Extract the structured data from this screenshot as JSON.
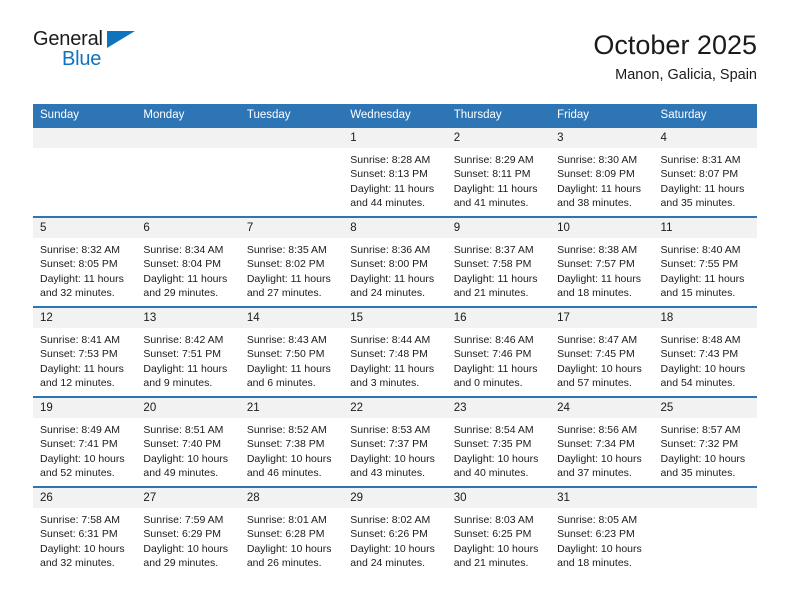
{
  "brand": {
    "line1": "General",
    "line2": "Blue",
    "flag_icon": "triangle-flag-icon",
    "accent_color": "#1073bd"
  },
  "header": {
    "title": "October 2025",
    "subtitle": "Manon, Galicia, Spain"
  },
  "calendar": {
    "header_color": "#2e75b6",
    "daynum_bg": "#f2f2f2",
    "weekdays": [
      "Sunday",
      "Monday",
      "Tuesday",
      "Wednesday",
      "Thursday",
      "Friday",
      "Saturday"
    ],
    "weeks": [
      [
        {
          "day": "",
          "sunrise": "",
          "sunset": "",
          "daylight1": "",
          "daylight2": ""
        },
        {
          "day": "",
          "sunrise": "",
          "sunset": "",
          "daylight1": "",
          "daylight2": ""
        },
        {
          "day": "",
          "sunrise": "",
          "sunset": "",
          "daylight1": "",
          "daylight2": ""
        },
        {
          "day": "1",
          "sunrise": "Sunrise: 8:28 AM",
          "sunset": "Sunset: 8:13 PM",
          "daylight1": "Daylight: 11 hours",
          "daylight2": "and 44 minutes."
        },
        {
          "day": "2",
          "sunrise": "Sunrise: 8:29 AM",
          "sunset": "Sunset: 8:11 PM",
          "daylight1": "Daylight: 11 hours",
          "daylight2": "and 41 minutes."
        },
        {
          "day": "3",
          "sunrise": "Sunrise: 8:30 AM",
          "sunset": "Sunset: 8:09 PM",
          "daylight1": "Daylight: 11 hours",
          "daylight2": "and 38 minutes."
        },
        {
          "day": "4",
          "sunrise": "Sunrise: 8:31 AM",
          "sunset": "Sunset: 8:07 PM",
          "daylight1": "Daylight: 11 hours",
          "daylight2": "and 35 minutes."
        }
      ],
      [
        {
          "day": "5",
          "sunrise": "Sunrise: 8:32 AM",
          "sunset": "Sunset: 8:05 PM",
          "daylight1": "Daylight: 11 hours",
          "daylight2": "and 32 minutes."
        },
        {
          "day": "6",
          "sunrise": "Sunrise: 8:34 AM",
          "sunset": "Sunset: 8:04 PM",
          "daylight1": "Daylight: 11 hours",
          "daylight2": "and 29 minutes."
        },
        {
          "day": "7",
          "sunrise": "Sunrise: 8:35 AM",
          "sunset": "Sunset: 8:02 PM",
          "daylight1": "Daylight: 11 hours",
          "daylight2": "and 27 minutes."
        },
        {
          "day": "8",
          "sunrise": "Sunrise: 8:36 AM",
          "sunset": "Sunset: 8:00 PM",
          "daylight1": "Daylight: 11 hours",
          "daylight2": "and 24 minutes."
        },
        {
          "day": "9",
          "sunrise": "Sunrise: 8:37 AM",
          "sunset": "Sunset: 7:58 PM",
          "daylight1": "Daylight: 11 hours",
          "daylight2": "and 21 minutes."
        },
        {
          "day": "10",
          "sunrise": "Sunrise: 8:38 AM",
          "sunset": "Sunset: 7:57 PM",
          "daylight1": "Daylight: 11 hours",
          "daylight2": "and 18 minutes."
        },
        {
          "day": "11",
          "sunrise": "Sunrise: 8:40 AM",
          "sunset": "Sunset: 7:55 PM",
          "daylight1": "Daylight: 11 hours",
          "daylight2": "and 15 minutes."
        }
      ],
      [
        {
          "day": "12",
          "sunrise": "Sunrise: 8:41 AM",
          "sunset": "Sunset: 7:53 PM",
          "daylight1": "Daylight: 11 hours",
          "daylight2": "and 12 minutes."
        },
        {
          "day": "13",
          "sunrise": "Sunrise: 8:42 AM",
          "sunset": "Sunset: 7:51 PM",
          "daylight1": "Daylight: 11 hours",
          "daylight2": "and 9 minutes."
        },
        {
          "day": "14",
          "sunrise": "Sunrise: 8:43 AM",
          "sunset": "Sunset: 7:50 PM",
          "daylight1": "Daylight: 11 hours",
          "daylight2": "and 6 minutes."
        },
        {
          "day": "15",
          "sunrise": "Sunrise: 8:44 AM",
          "sunset": "Sunset: 7:48 PM",
          "daylight1": "Daylight: 11 hours",
          "daylight2": "and 3 minutes."
        },
        {
          "day": "16",
          "sunrise": "Sunrise: 8:46 AM",
          "sunset": "Sunset: 7:46 PM",
          "daylight1": "Daylight: 11 hours",
          "daylight2": "and 0 minutes."
        },
        {
          "day": "17",
          "sunrise": "Sunrise: 8:47 AM",
          "sunset": "Sunset: 7:45 PM",
          "daylight1": "Daylight: 10 hours",
          "daylight2": "and 57 minutes."
        },
        {
          "day": "18",
          "sunrise": "Sunrise: 8:48 AM",
          "sunset": "Sunset: 7:43 PM",
          "daylight1": "Daylight: 10 hours",
          "daylight2": "and 54 minutes."
        }
      ],
      [
        {
          "day": "19",
          "sunrise": "Sunrise: 8:49 AM",
          "sunset": "Sunset: 7:41 PM",
          "daylight1": "Daylight: 10 hours",
          "daylight2": "and 52 minutes."
        },
        {
          "day": "20",
          "sunrise": "Sunrise: 8:51 AM",
          "sunset": "Sunset: 7:40 PM",
          "daylight1": "Daylight: 10 hours",
          "daylight2": "and 49 minutes."
        },
        {
          "day": "21",
          "sunrise": "Sunrise: 8:52 AM",
          "sunset": "Sunset: 7:38 PM",
          "daylight1": "Daylight: 10 hours",
          "daylight2": "and 46 minutes."
        },
        {
          "day": "22",
          "sunrise": "Sunrise: 8:53 AM",
          "sunset": "Sunset: 7:37 PM",
          "daylight1": "Daylight: 10 hours",
          "daylight2": "and 43 minutes."
        },
        {
          "day": "23",
          "sunrise": "Sunrise: 8:54 AM",
          "sunset": "Sunset: 7:35 PM",
          "daylight1": "Daylight: 10 hours",
          "daylight2": "and 40 minutes."
        },
        {
          "day": "24",
          "sunrise": "Sunrise: 8:56 AM",
          "sunset": "Sunset: 7:34 PM",
          "daylight1": "Daylight: 10 hours",
          "daylight2": "and 37 minutes."
        },
        {
          "day": "25",
          "sunrise": "Sunrise: 8:57 AM",
          "sunset": "Sunset: 7:32 PM",
          "daylight1": "Daylight: 10 hours",
          "daylight2": "and 35 minutes."
        }
      ],
      [
        {
          "day": "26",
          "sunrise": "Sunrise: 7:58 AM",
          "sunset": "Sunset: 6:31 PM",
          "daylight1": "Daylight: 10 hours",
          "daylight2": "and 32 minutes."
        },
        {
          "day": "27",
          "sunrise": "Sunrise: 7:59 AM",
          "sunset": "Sunset: 6:29 PM",
          "daylight1": "Daylight: 10 hours",
          "daylight2": "and 29 minutes."
        },
        {
          "day": "28",
          "sunrise": "Sunrise: 8:01 AM",
          "sunset": "Sunset: 6:28 PM",
          "daylight1": "Daylight: 10 hours",
          "daylight2": "and 26 minutes."
        },
        {
          "day": "29",
          "sunrise": "Sunrise: 8:02 AM",
          "sunset": "Sunset: 6:26 PM",
          "daylight1": "Daylight: 10 hours",
          "daylight2": "and 24 minutes."
        },
        {
          "day": "30",
          "sunrise": "Sunrise: 8:03 AM",
          "sunset": "Sunset: 6:25 PM",
          "daylight1": "Daylight: 10 hours",
          "daylight2": "and 21 minutes."
        },
        {
          "day": "31",
          "sunrise": "Sunrise: 8:05 AM",
          "sunset": "Sunset: 6:23 PM",
          "daylight1": "Daylight: 10 hours",
          "daylight2": "and 18 minutes."
        },
        {
          "day": "",
          "sunrise": "",
          "sunset": "",
          "daylight1": "",
          "daylight2": ""
        }
      ]
    ]
  }
}
